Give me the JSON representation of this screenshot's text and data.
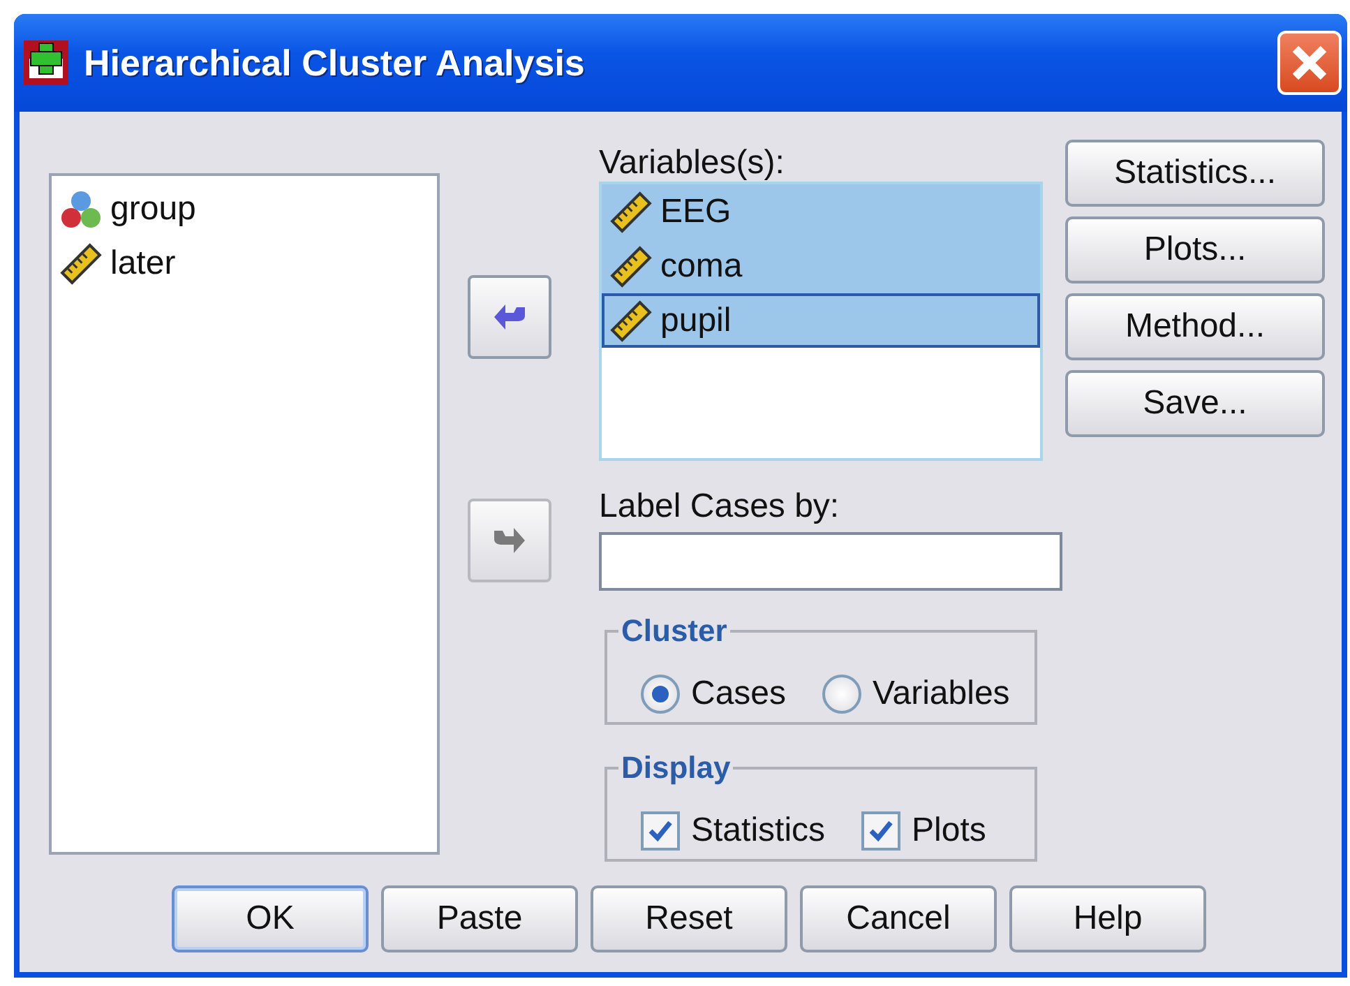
{
  "window": {
    "title": "Hierarchical Cluster Analysis"
  },
  "source_list": {
    "items": [
      {
        "name": "group",
        "kind": "nominal",
        "selected": false
      },
      {
        "name": "later",
        "kind": "scale",
        "selected": false
      }
    ]
  },
  "move_buttons": [
    {
      "disabled": false
    },
    {
      "disabled": true
    }
  ],
  "variables": {
    "label": "Variables(s):",
    "items": [
      {
        "name": "EEG",
        "kind": "scale",
        "selected": true,
        "focused": false
      },
      {
        "name": "coma",
        "kind": "scale",
        "selected": true,
        "focused": false
      },
      {
        "name": "pupil",
        "kind": "scale",
        "selected": true,
        "focused": true
      }
    ]
  },
  "label_cases": {
    "label": "Label Cases by:"
  },
  "cluster": {
    "title": "Cluster",
    "options": [
      {
        "label": "Cases",
        "selected": true
      },
      {
        "label": "Variables",
        "selected": false
      }
    ]
  },
  "display": {
    "title": "Display",
    "options": [
      {
        "label": "Statistics",
        "checked": true
      },
      {
        "label": "Plots",
        "checked": true
      }
    ]
  },
  "side_buttons": [
    "Statistics...",
    "Plots...",
    "Method...",
    "Save..."
  ],
  "bottom_buttons": [
    {
      "label": "OK",
      "default": true
    },
    {
      "label": "Paste",
      "default": false
    },
    {
      "label": "Reset",
      "default": false
    },
    {
      "label": "Cancel",
      "default": false
    },
    {
      "label": "Help",
      "default": false
    }
  ]
}
